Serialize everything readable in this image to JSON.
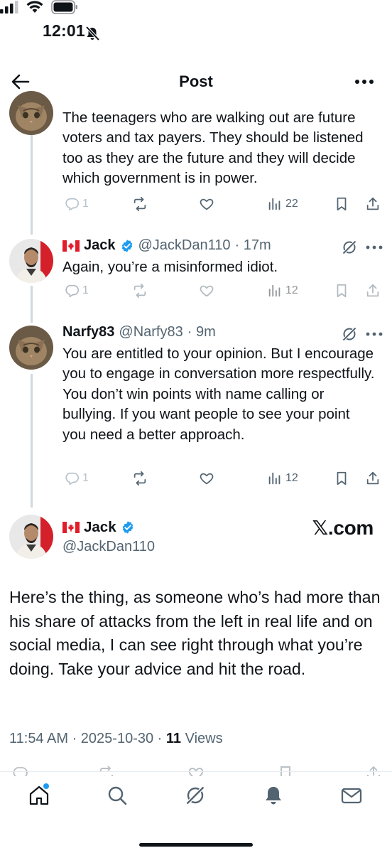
{
  "status_bar": {
    "time": "12:01"
  },
  "header": {
    "title": "Post"
  },
  "tweets": [
    {
      "text": "The teenagers who are walking out are future voters and tax payers. They should be listened too as they are the future and they will decide which government is in power.",
      "replies": "1",
      "views": "22"
    },
    {
      "name": "Jack",
      "handle": "@JackDan110",
      "time": "· 17m",
      "text": "Again, you’re a misinformed idiot.",
      "replies": "1",
      "views": "12"
    },
    {
      "name": "Narfy83",
      "handle": "@Narfy83",
      "time": "· 9m",
      "text": "You are entitled to your opinion. But I encourage you to engage in conversation more respectfully. You don’t win points with name calling or bullying. If you want people to see your point you need a better approach.",
      "replies": "1",
      "views": "12"
    }
  ],
  "main_tweet": {
    "name": "Jack",
    "handle": "@JackDan110",
    "watermark": "𝕏.com",
    "text": "Here’s the thing, as someone who’s had more than his share of attacks from the left in real life and on social media, I can see right through what you’re doing.  Take your advice and hit the road.",
    "time": "11:54 AM",
    "date": "· 2025-10-30 ·",
    "views_count": "11",
    "views_label": "Views"
  },
  "colors": {
    "text": "#0f1419",
    "secondary": "#536471",
    "verified": "#1d9bf0",
    "thread": "#cfd9de",
    "flag_red": "#e11d2a"
  },
  "icons": {
    "back": "arrow-left-icon",
    "more": "more-horizontal-icon",
    "reply": "reply-icon",
    "repost": "repost-icon",
    "like": "heart-icon",
    "views": "views-icon",
    "bookmark": "bookmark-icon",
    "share": "share-icon",
    "grok": "grok-icon"
  }
}
